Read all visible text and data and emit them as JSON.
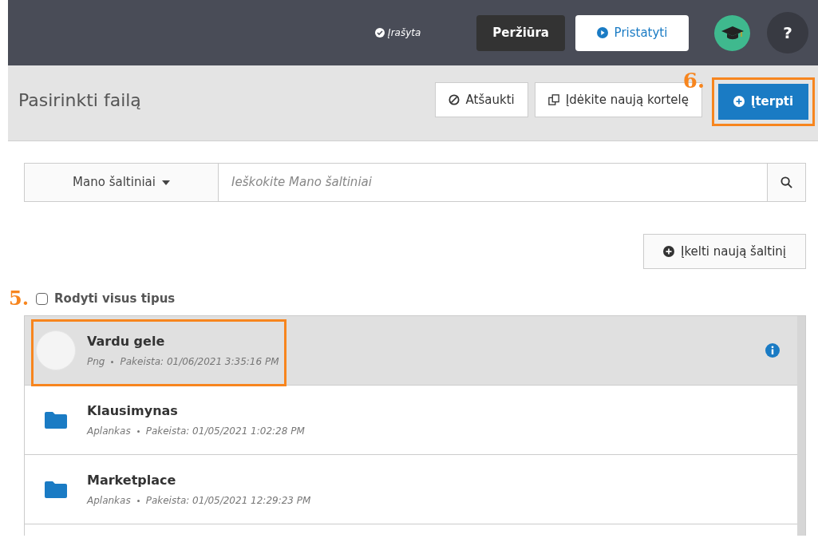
{
  "topbar": {
    "status": "Įrašyta",
    "preview_button": "Peržiūra",
    "present_button": "Pristatyti",
    "help_button": "?"
  },
  "header": {
    "title": "Pasirinkti failą",
    "cancel_button": "Atšaukti",
    "new_card_button": "Įdėkite naują kortelę",
    "insert_button": "Įterpti"
  },
  "search": {
    "source_dropdown": "Mano šaltiniai",
    "placeholder": "Ieškokite Mano šaltiniai"
  },
  "upload_button": "Įkelti naują šaltinį",
  "show_all_types": {
    "label": "Rodyti visus tipus",
    "checked": false
  },
  "files": [
    {
      "kind": "image",
      "name": "Vardu gele",
      "type": "Png",
      "modified": "Pakeista: 01/06/2021 3:35:16 PM",
      "selected": true
    },
    {
      "kind": "folder",
      "name": "Klausimynas",
      "type": "Aplankas",
      "modified": "Pakeista: 01/05/2021 1:02:28 PM",
      "selected": false
    },
    {
      "kind": "folder",
      "name": "Marketplace",
      "type": "Aplankas",
      "modified": "Pakeista: 01/05/2021 12:29:23 PM",
      "selected": false
    }
  ],
  "annotations": [
    "5.",
    "6."
  ]
}
